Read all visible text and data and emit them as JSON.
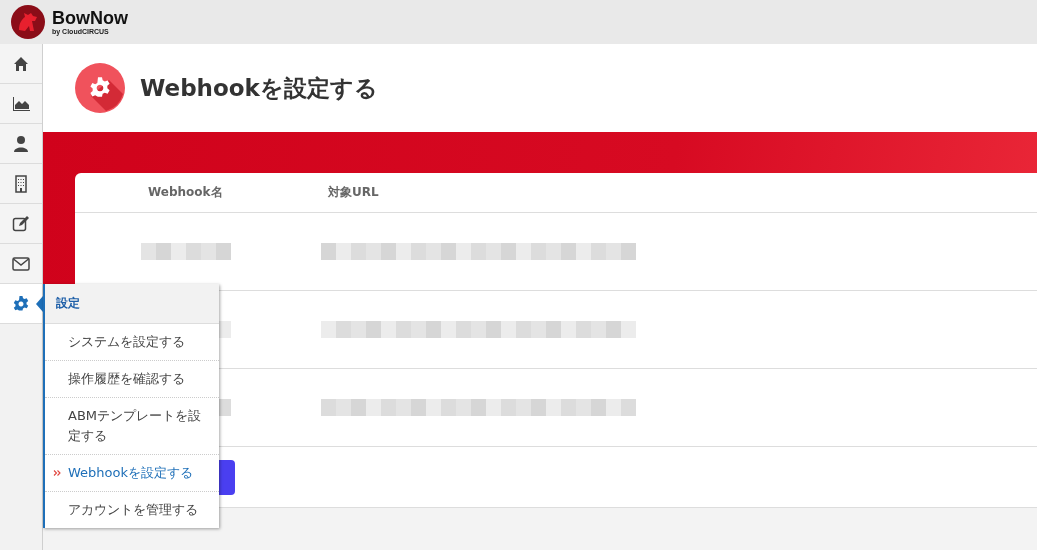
{
  "brand": {
    "name": "BowNow",
    "byline": "by CloudCIRCUS"
  },
  "sidebar": {
    "items": [
      {
        "kind": "home",
        "selected": false
      },
      {
        "kind": "chart",
        "selected": false
      },
      {
        "kind": "person",
        "selected": false
      },
      {
        "kind": "building",
        "selected": false
      },
      {
        "kind": "edit",
        "selected": false
      },
      {
        "kind": "mail",
        "selected": false
      },
      {
        "kind": "gear",
        "selected": true
      }
    ]
  },
  "page": {
    "title": "Webhookを設定する"
  },
  "table": {
    "columns": [
      "Webhook名",
      "対象URL"
    ],
    "rows": [
      {
        "kind": "redacted"
      },
      {
        "kind": "redacted"
      },
      {
        "kind": "redacted"
      }
    ]
  },
  "flyout": {
    "title": "設定",
    "items": [
      {
        "label": "システムを設定する",
        "selected": false
      },
      {
        "label": "操作履歴を確認する",
        "selected": false
      },
      {
        "label": "ABMテンプレートを設定する",
        "selected": false
      },
      {
        "label": "Webhookを設定する",
        "selected": true
      },
      {
        "label": "アカウントを管理する",
        "selected": false
      }
    ]
  }
}
